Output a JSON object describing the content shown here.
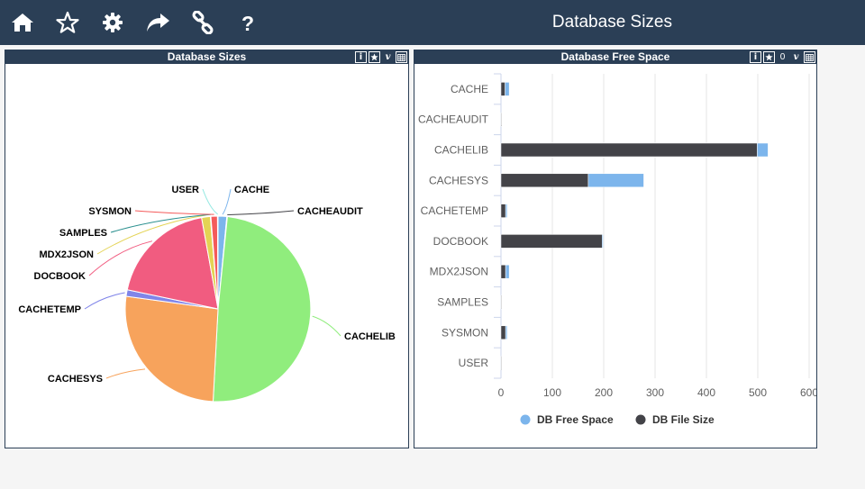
{
  "app": {
    "title": "Database Sizes"
  },
  "toolbar": [
    "home-icon",
    "star-icon",
    "gear-icon",
    "share-icon",
    "link-icon",
    "help-icon"
  ],
  "panels": {
    "sizes": {
      "title": "Database Sizes",
      "buttons": [
        "i",
        "v"
      ]
    },
    "free": {
      "title": "Database Free Space",
      "buttons": [
        "i",
        "0",
        "v"
      ]
    }
  },
  "colors": {
    "header": "#2b3f56",
    "free_space": "#7cb5ec",
    "file_size": "#434348"
  },
  "chart_data": [
    {
      "type": "pie",
      "title": "",
      "labels": [
        "CACHE",
        "CACHEAUDIT",
        "CACHELIB",
        "CACHESYS",
        "CACHETEMP",
        "DOCBOOK",
        "MDX2JSON",
        "SAMPLES",
        "SYSMON",
        "USER"
      ],
      "values": [
        16,
        1,
        520,
        278,
        12,
        199,
        16,
        1,
        12,
        1
      ],
      "colors": [
        "#7cb5ec",
        "#434348",
        "#90ed7d",
        "#f7a35c",
        "#8085e9",
        "#f15c80",
        "#e4d354",
        "#2b908f",
        "#f45b5b",
        "#91e8e1"
      ]
    },
    {
      "type": "bar",
      "orientation": "horizontal",
      "stacked": true,
      "title": "",
      "categories": [
        "CACHE",
        "CACHEAUDIT",
        "CACHELIB",
        "CACHESYS",
        "CACHETEMP",
        "DOCBOOK",
        "MDX2JSON",
        "SAMPLES",
        "SYSMON",
        "USER"
      ],
      "series": [
        {
          "name": "DB Free Space",
          "color": "#7cb5ec",
          "values": [
            8,
            0,
            21,
            108,
            3,
            2,
            7,
            0,
            3,
            0
          ]
        },
        {
          "name": "DB File Size",
          "color": "#434348",
          "values": [
            8,
            1,
            499,
            170,
            9,
            197,
            9,
            1,
            9,
            1
          ]
        }
      ],
      "xlim": [
        0,
        600
      ],
      "xticks": [
        0,
        100,
        200,
        300,
        400,
        500,
        600
      ],
      "legend": "bottom",
      "grid": true
    }
  ]
}
